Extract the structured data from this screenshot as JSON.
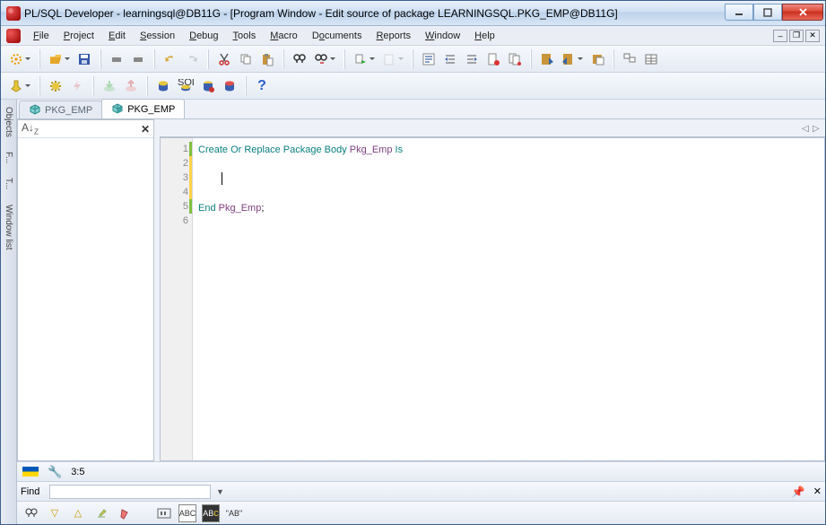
{
  "title": "PL/SQL Developer - learningsql@DB11G - [Program Window - Edit source of package LEARNINGSQL.PKG_EMP@DB11G]",
  "menu": {
    "file": "File",
    "project": "Project",
    "edit": "Edit",
    "session": "Session",
    "debug": "Debug",
    "tools": "Tools",
    "macro": "Macro",
    "documents": "Documents",
    "reports": "Reports",
    "window": "Window",
    "help": "Help"
  },
  "vtabs": {
    "objects": "Objects",
    "f": "F...",
    "t": "T...",
    "wl": "Window list"
  },
  "tabs": [
    {
      "label": "PKG_EMP",
      "active": false
    },
    {
      "label": "PKG_EMP",
      "active": true
    }
  ],
  "code": {
    "lines": [
      {
        "n": "1",
        "seg": [
          {
            "t": "Create Or Replace Package Body ",
            "c": "kw"
          },
          {
            "t": "Pkg_Emp",
            "c": "id"
          },
          {
            "t": " Is",
            "c": "kw"
          }
        ]
      },
      {
        "n": "2",
        "seg": []
      },
      {
        "n": "3",
        "seg": [],
        "cursor": true
      },
      {
        "n": "4",
        "seg": []
      },
      {
        "n": "5",
        "seg": [
          {
            "t": "End ",
            "c": "kw"
          },
          {
            "t": "Pkg_Emp",
            "c": "id"
          },
          {
            "t": ";",
            "c": ""
          }
        ]
      },
      {
        "n": "6",
        "seg": []
      }
    ]
  },
  "status": {
    "pos": "3:5"
  },
  "find": {
    "label": "Find",
    "value": "",
    "abtext": "\"AB\""
  }
}
